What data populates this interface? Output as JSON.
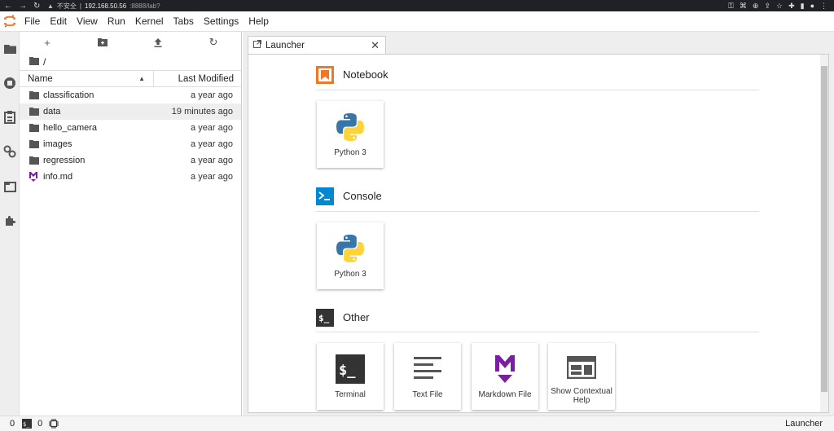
{
  "browser": {
    "security_label": "不安全",
    "host": "192.168.50.56",
    "path": ":8888/lab?"
  },
  "menubar": {
    "items": [
      "File",
      "Edit",
      "View",
      "Run",
      "Kernel",
      "Tabs",
      "Settings",
      "Help"
    ]
  },
  "filebrowser": {
    "breadcrumb": "/",
    "columns": {
      "name": "Name",
      "modified": "Last Modified"
    },
    "files": [
      {
        "name": "classification",
        "modified": "a year ago",
        "kind": "folder"
      },
      {
        "name": "data",
        "modified": "19 minutes ago",
        "kind": "folder"
      },
      {
        "name": "hello_camera",
        "modified": "a year ago",
        "kind": "folder"
      },
      {
        "name": "images",
        "modified": "a year ago",
        "kind": "folder"
      },
      {
        "name": "regression",
        "modified": "a year ago",
        "kind": "folder"
      },
      {
        "name": "info.md",
        "modified": "a year ago",
        "kind": "markdown"
      }
    ]
  },
  "tab": {
    "label": "Launcher"
  },
  "launcher": {
    "notebook": {
      "title": "Notebook",
      "cards": [
        "Python 3"
      ]
    },
    "console": {
      "title": "Console",
      "cards": [
        "Python 3"
      ]
    },
    "other": {
      "title": "Other",
      "cards": [
        "Terminal",
        "Text File",
        "Markdown File",
        "Show Contextual Help"
      ]
    }
  },
  "statusbar": {
    "terminals": "0",
    "kernels": "0",
    "mode": "Launcher"
  },
  "colors": {
    "notebook_orange": "#f37626",
    "console_blue": "#0288d1",
    "markdown_purple": "#7b1fa2",
    "terminal_dark": "#333333"
  }
}
